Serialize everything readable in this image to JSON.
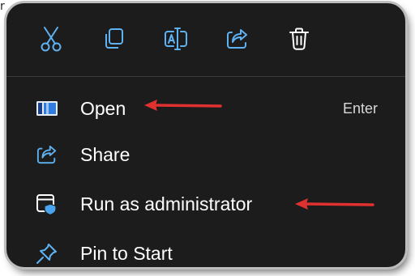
{
  "corner_glyph": "r",
  "toolbar": {
    "buttons": [
      {
        "icon": "cut-icon",
        "color": "#5fb2f2"
      },
      {
        "icon": "copy-icon",
        "color": "#5fb2f2"
      },
      {
        "icon": "rename-icon",
        "color": "#5fb2f2"
      },
      {
        "icon": "share-icon",
        "color": "#5fb2f2"
      },
      {
        "icon": "delete-icon",
        "color": "#ffffff"
      }
    ]
  },
  "menu": {
    "items": [
      {
        "label": "Open",
        "shortcut": "Enter",
        "icon": "open-window-icon"
      },
      {
        "label": "Share",
        "shortcut": "",
        "icon": "share-icon"
      },
      {
        "label": "Run as administrator",
        "shortcut": "",
        "icon": "shield-window-icon"
      },
      {
        "label": "Pin to Start",
        "shortcut": "",
        "icon": "pin-icon"
      }
    ]
  },
  "annotations": {
    "arrow_color": "#e03131"
  }
}
